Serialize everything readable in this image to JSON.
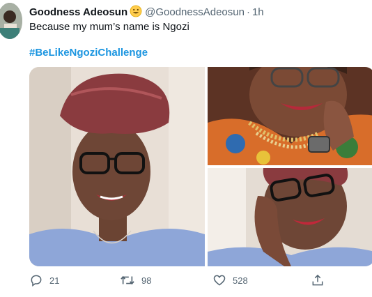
{
  "tweet": {
    "author_name": "Goodness Adeosun",
    "emoji": "smiling-face-emoji",
    "handle": "@GoodnessAdeosun",
    "separator": "·",
    "time": "1h",
    "text": "Because my mum’s name is Ngozi",
    "hashtag": "#BeLikeNgoziChallenge",
    "photos": [
      {
        "description_icon": "photo-selfie-head-wrap"
      },
      {
        "description_icon": "photo-woman-smiling-beads"
      },
      {
        "description_icon": "photo-selfie-hand-on-cheek"
      }
    ]
  },
  "actions": {
    "reply_count": "21",
    "retweet_count": "98",
    "like_count": "528",
    "share_icon": "share-icon"
  },
  "colors": {
    "link": "#1b95e0",
    "muted": "#536471",
    "text": "#0f1419"
  }
}
